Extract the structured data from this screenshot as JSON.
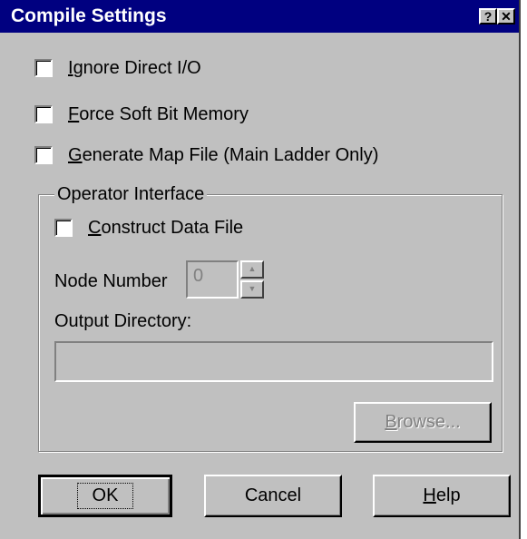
{
  "window": {
    "title": "Compile Settings",
    "help_button": "?",
    "close_button": "✕"
  },
  "options": {
    "ignore_direct_io": {
      "mnemonic": "I",
      "rest": "gnore Direct I/O",
      "checked": false
    },
    "force_soft_bit": {
      "mnemonic": "F",
      "rest": "orce Soft Bit Memory",
      "checked": false
    },
    "generate_map": {
      "mnemonic": "G",
      "rest": "enerate Map File (Main Ladder Only)",
      "checked": false
    }
  },
  "operator_interface": {
    "legend": "Operator Interface",
    "construct_data_file": {
      "mnemonic": "C",
      "rest": "onstruct Data File",
      "checked": false
    },
    "node_number_label": "Node Number",
    "node_number_value": "0",
    "output_directory_label": "Output Directory:",
    "output_directory_value": "",
    "browse": {
      "mnemonic": "B",
      "rest": "rowse..."
    }
  },
  "buttons": {
    "ok": "OK",
    "cancel": "Cancel",
    "help": {
      "mnemonic": "H",
      "rest": "elp"
    }
  },
  "colors": {
    "titlebar": "#000080",
    "face": "#c0c0c0",
    "disabled_text": "#808080"
  }
}
